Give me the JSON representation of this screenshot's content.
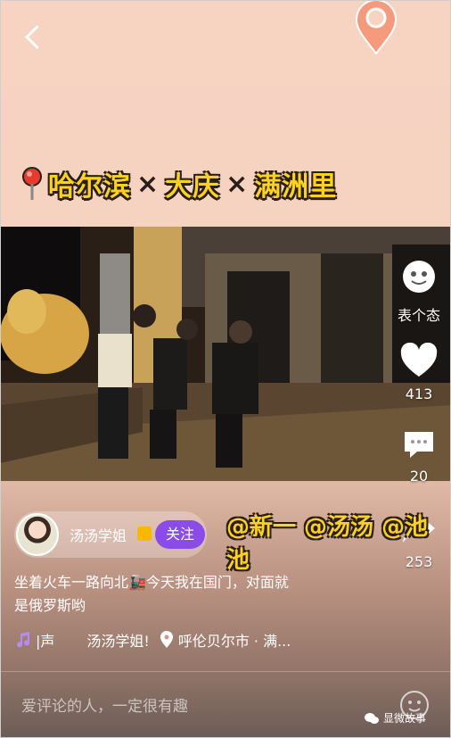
{
  "header": {
    "back_icon": "chevron-left-icon",
    "location_icon": "map-pin-icon"
  },
  "title": {
    "city1": "哈尔滨",
    "sep": "×",
    "city2": "大庆",
    "city3": "满洲里",
    "colors": {
      "text": "#ffd21f",
      "outline": "#2a1e18"
    }
  },
  "rail": {
    "emote_label": "表个态",
    "like_count": "413",
    "comment_count": "20",
    "share_count": "253"
  },
  "author": {
    "name": "汤汤学姐",
    "follow_label": "关注",
    "follow_color": "#8b4be8"
  },
  "mentions": "@新一 @汤汤 @池池",
  "description": {
    "line1": "坐着火车一路向北🚂今天我在国门，对面就",
    "line2": "是俄罗斯哟"
  },
  "meta": {
    "sound_label": "|声",
    "sound_author": "汤汤学姐!",
    "location": "呼伦贝尔市 · 满..."
  },
  "comment": {
    "placeholder": "爱评论的人，一定很有趣"
  },
  "watermark": "显微故事"
}
